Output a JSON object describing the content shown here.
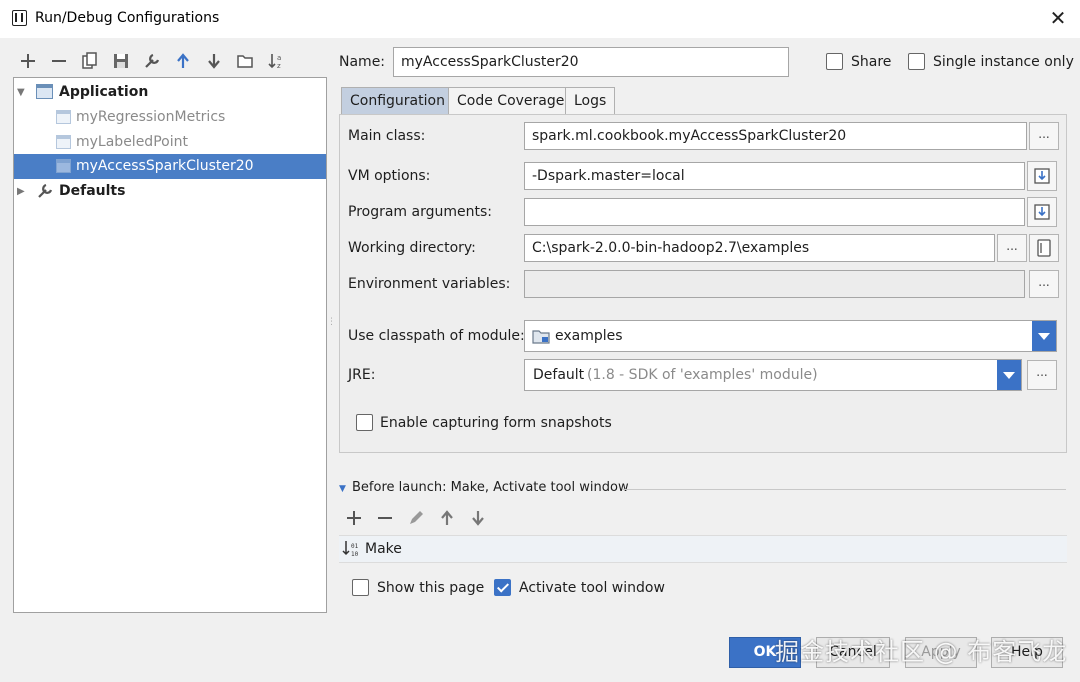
{
  "window": {
    "title": "Run/Debug Configurations"
  },
  "toolbar": {
    "icons": [
      "add-icon",
      "remove-icon",
      "copy-icon",
      "save-icon",
      "wrench-icon",
      "move-up-icon",
      "move-down-icon",
      "folder-icon",
      "sort-icon"
    ]
  },
  "tree": {
    "application_label": "Application",
    "items": [
      {
        "label": "myRegressionMetrics",
        "state": "temporary"
      },
      {
        "label": "myLabeledPoint",
        "state": "temporary"
      },
      {
        "label": "myAccessSparkCluster20",
        "state": "selected"
      }
    ],
    "defaults_label": "Defaults"
  },
  "form": {
    "name_label": "Name:",
    "name_value": "myAccessSparkCluster20",
    "share_label": "Share",
    "share_checked": false,
    "single_instance_label": "Single instance only",
    "single_instance_checked": false,
    "tabs": [
      "Configuration",
      "Code Coverage",
      "Logs"
    ],
    "active_tab": "Configuration",
    "main_class_label": "Main class:",
    "main_class_value": "spark.ml.cookbook.myAccessSparkCluster20",
    "vm_options_label": "VM options:",
    "vm_options_value": "-Dspark.master=local",
    "program_args_label": "Program arguments:",
    "program_args_value": "",
    "working_dir_label": "Working directory:",
    "working_dir_value": "C:\\spark-2.0.0-bin-hadoop2.7\\examples",
    "env_vars_label": "Environment variables:",
    "env_vars_value": "",
    "classpath_label": "Use classpath of module:",
    "classpath_value": "examples",
    "jre_label": "JRE:",
    "jre_value": "Default",
    "jre_detail": "(1.8 - SDK of 'examples' module)",
    "capture_label": "Enable capturing form snapshots",
    "capture_checked": false,
    "ellipsis": "..."
  },
  "before_launch": {
    "title": "Before launch: Make, Activate tool window",
    "tools": [
      "add-icon",
      "remove-icon",
      "edit-icon",
      "move-up-icon",
      "move-down-icon"
    ],
    "task": "Make"
  },
  "footer": {
    "show_page_label": "Show this page",
    "show_page_checked": false,
    "activate_label": "Activate tool window",
    "activate_checked": true,
    "ok": "OK",
    "cancel": "Cancel",
    "apply": "Apply",
    "help": "Help",
    "watermark": "掘金技术社区 @ 布客飞龙"
  },
  "colors": {
    "selection": "#4a7ec6",
    "accent": "#3b72c6",
    "active_tab": "#c3cfe0"
  }
}
